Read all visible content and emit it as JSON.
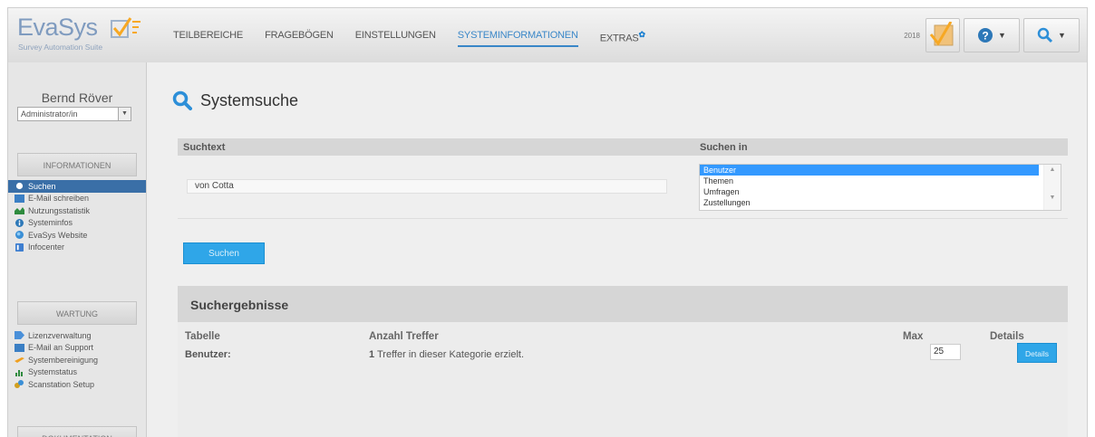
{
  "logo": {
    "brand": "EvaSys",
    "subtitle": "Survey Automation Suite"
  },
  "nav": [
    {
      "label": "TEILBEREICHE",
      "active": false
    },
    {
      "label": "FRAGEBÖGEN",
      "active": false
    },
    {
      "label": "EINSTELLUNGEN",
      "active": false
    },
    {
      "label": "SYSTEMINFORMATIONEN",
      "active": true
    },
    {
      "label": "EXTRAS",
      "active": false
    }
  ],
  "extras_badge": "✿",
  "header_tools": {
    "year": "2018"
  },
  "user": {
    "name": "Bernd Röver",
    "role": "Administrator/in"
  },
  "sidebar": {
    "sections": [
      {
        "title": "INFORMATIONEN",
        "items": [
          {
            "label": "Suchen",
            "icon": "search-icon",
            "active": true
          },
          {
            "label": "E-Mail schreiben",
            "icon": "mail-icon"
          },
          {
            "label": "Nutzungsstatistik",
            "icon": "chart-icon"
          },
          {
            "label": "Systeminfos",
            "icon": "info-icon"
          },
          {
            "label": "EvaSys Website",
            "icon": "globe-icon"
          },
          {
            "label": "Infocenter",
            "icon": "book-icon"
          }
        ]
      },
      {
        "title": "WARTUNG",
        "items": [
          {
            "label": "Lizenzverwaltung",
            "icon": "key-icon"
          },
          {
            "label": "E-Mail an Support",
            "icon": "mail-icon"
          },
          {
            "label": "Systembereinigung",
            "icon": "broom-icon"
          },
          {
            "label": "Systemstatus",
            "icon": "status-icon"
          },
          {
            "label": "Scanstation Setup",
            "icon": "scanner-icon"
          }
        ]
      },
      {
        "title": "DOKUMENTATION",
        "items": []
      }
    ]
  },
  "page": {
    "title": "Systemsuche"
  },
  "search": {
    "suchtext_label": "Suchtext",
    "suchen_in_label": "Suchen in",
    "query": "von Cotta",
    "options": [
      "Benutzer",
      "Themen",
      "Umfragen",
      "Zustellungen"
    ],
    "selected_option": "Benutzer",
    "button_label": "Suchen"
  },
  "results": {
    "title": "Suchergebnisse",
    "columns": {
      "table": "Tabelle",
      "hits": "Anzahl Treffer",
      "max": "Max",
      "details": "Details"
    },
    "rows": [
      {
        "table": "Benutzer:",
        "hits_count": "1",
        "hits_text": " Treffer in dieser Kategorie erzielt.",
        "max": "25",
        "details_label": "Details"
      }
    ]
  },
  "colors": {
    "accent": "#3a87c8",
    "button": "#2fa6e8",
    "sidebar_active": "#3a6fa7",
    "logo_check": "#f7a823"
  }
}
